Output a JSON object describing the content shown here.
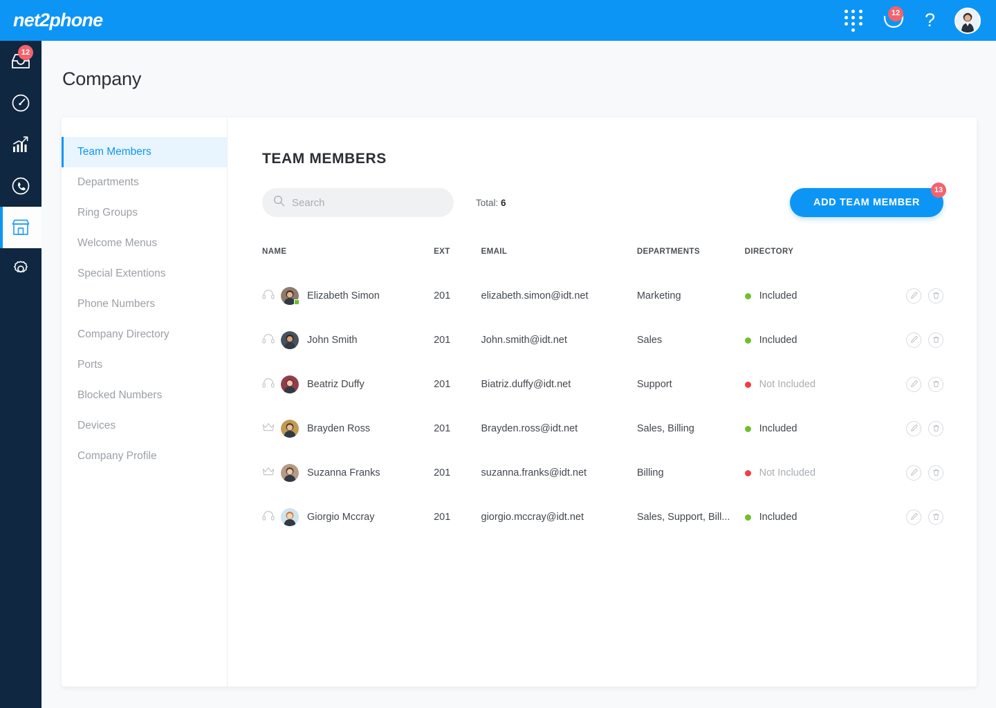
{
  "brand": {
    "logo_text": "net2phone",
    "accent": "#0d95f5",
    "rail_bg": "#0f2740"
  },
  "topbar": {
    "dialpad_label": "Dialpad",
    "messages_badge": "12",
    "help_label": "?",
    "avatar_label": "Account"
  },
  "rail": {
    "inbox_badge": "12",
    "items": [
      {
        "name": "inbox",
        "label": "Inbox"
      },
      {
        "name": "dashboard",
        "label": "Dashboard"
      },
      {
        "name": "analytics",
        "label": "Analytics"
      },
      {
        "name": "calls",
        "label": "Calls"
      },
      {
        "name": "company",
        "label": "Company"
      },
      {
        "name": "settings",
        "label": "Settings"
      }
    ]
  },
  "page": {
    "title": "Company"
  },
  "nav": {
    "items": [
      {
        "label": "Team Members",
        "active": true
      },
      {
        "label": "Departments",
        "active": false
      },
      {
        "label": "Ring Groups",
        "active": false
      },
      {
        "label": "Welcome Menus",
        "active": false
      },
      {
        "label": "Special Extentions",
        "active": false
      },
      {
        "label": "Phone Numbers",
        "active": false
      },
      {
        "label": "Company Directory",
        "active": false
      },
      {
        "label": "Ports",
        "active": false
      },
      {
        "label": "Blocked Numbers",
        "active": false
      },
      {
        "label": "Devices",
        "active": false
      },
      {
        "label": "Company Profile",
        "active": false
      }
    ]
  },
  "main": {
    "heading": "TEAM MEMBERS",
    "search": {
      "value": "",
      "placeholder": "Search"
    },
    "total_label": "Total:",
    "total_value": "6",
    "add_button": {
      "label": "ADD TEAM MEMBER",
      "badge": "13"
    },
    "columns": [
      "NAME",
      "EXT",
      "EMAIL",
      "DEPARTMENTS",
      "DIRECTORY"
    ],
    "status_colors": {
      "included": "#6fbf2f",
      "not_included": "#ef3e42"
    },
    "rows": [
      {
        "role_icon": "headset-icon",
        "name": "Elizabeth Simon",
        "ext": "201",
        "email": "elizabeth.simon@idt.net",
        "departments": "Marketing",
        "directory": "Included",
        "included": true,
        "online": true,
        "avatar_bg": "#8d7b6b"
      },
      {
        "role_icon": "headset-icon",
        "name": "John Smith",
        "ext": "201",
        "email": "John.smith@idt.net",
        "departments": "Sales",
        "directory": "Included",
        "included": true,
        "online": false,
        "avatar_bg": "#46525e"
      },
      {
        "role_icon": "headset-icon",
        "name": "Beatriz Duffy",
        "ext": "201",
        "email": "Biatriz.duffy@idt.net",
        "departments": "Support",
        "directory": "Not Included",
        "included": false,
        "online": false,
        "avatar_bg": "#8e3f4a"
      },
      {
        "role_icon": "crown-icon",
        "name": "Brayden Ross",
        "ext": "201",
        "email": "Brayden.ross@idt.net",
        "departments": "Sales, Billing",
        "directory": "Included",
        "included": true,
        "online": false,
        "avatar_bg": "#c09a52"
      },
      {
        "role_icon": "crown-icon",
        "name": "Suzanna Franks",
        "ext": "201",
        "email": "suzanna.franks@idt.net",
        "departments": "Billing",
        "directory": "Not Included",
        "included": false,
        "online": false,
        "avatar_bg": "#b59b86"
      },
      {
        "role_icon": "headset-icon",
        "name": "Giorgio Mccray",
        "ext": "201",
        "email": "giorgio.mccray@idt.net",
        "departments": "Sales, Support, Bill...",
        "directory": "Included",
        "included": true,
        "online": false,
        "avatar_bg": "#cfe3f0"
      }
    ],
    "row_actions": {
      "edit": "edit-icon",
      "delete": "delete-icon"
    }
  }
}
